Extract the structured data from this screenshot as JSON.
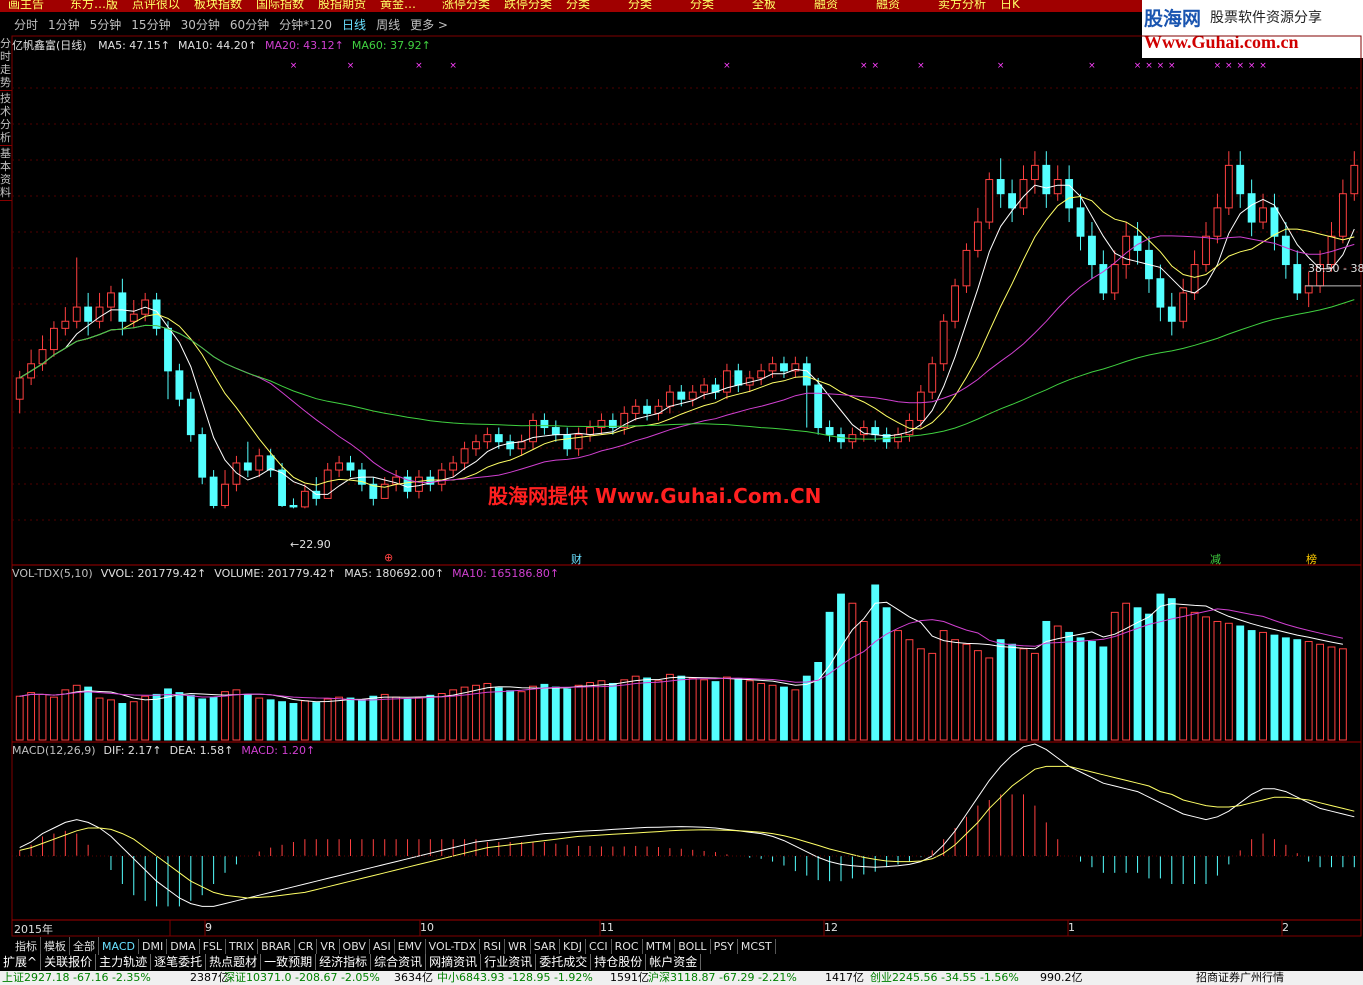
{
  "top_menu": [
    "画主告",
    "东方…版",
    "点评很以",
    "板块指数",
    "国际指数",
    "股指期货",
    "黄金…",
    "涨停分类",
    "跌停分类",
    "分类",
    "分类",
    "分类",
    "全板",
    "融资",
    "融资",
    "卖方分析",
    "日K"
  ],
  "timeframes": [
    {
      "label": "分时",
      "active": false
    },
    {
      "label": "1分钟",
      "active": false
    },
    {
      "label": "5分钟",
      "active": false
    },
    {
      "label": "15分钟",
      "active": false
    },
    {
      "label": "30分钟",
      "active": false
    },
    {
      "label": "60分钟",
      "active": false
    },
    {
      "label": "分钟*120",
      "active": false
    },
    {
      "label": "日线",
      "active": true
    },
    {
      "label": "周线",
      "active": false
    },
    {
      "label": "更多 >",
      "active": false
    }
  ],
  "logo": {
    "line1": "股海网",
    "line1b": "股票软件资源分享",
    "line2": "Www.Guhai.com.cn"
  },
  "side_tabs": [
    "分时走势",
    "技术分析",
    "基本资料"
  ],
  "watermark": "股海网提供 Www.Guhai.Com.CN",
  "price_panel": {
    "stock_title": "亿帆鑫富(日线)",
    "legend": [
      {
        "text": "MA5: 47.15↑",
        "color": "#e0e0e0"
      },
      {
        "text": "MA10: 44.20↑",
        "color": "#e0e0e0"
      },
      {
        "text": "MA20: 43.12↑",
        "color": "#d040d0"
      },
      {
        "text": "MA60: 37.92↑",
        "color": "#40d040"
      }
    ],
    "low_label": "←22.90",
    "cursor_label": "38.50 - 38",
    "event_markers": [
      {
        "text": "⊕",
        "color": "#ff4040"
      },
      {
        "text": "财",
        "color": "#6ae0ff"
      },
      {
        "text": "减",
        "color": "#40d040"
      },
      {
        "text": "榜",
        "color": "#ffcc00"
      }
    ]
  },
  "volume_panel": {
    "legend": [
      {
        "text": "VOL-TDX(5,10)",
        "color": "#c0c0c0"
      },
      {
        "text": "VVOL: 201779.42↑",
        "color": "#e0e0e0"
      },
      {
        "text": "VOLUME: 201779.42↑",
        "color": "#e0e0e0"
      },
      {
        "text": "MA5: 180692.00↑",
        "color": "#e0e0e0"
      },
      {
        "text": "MA10: 165186.80↑",
        "color": "#d040d0"
      }
    ]
  },
  "macd_panel": {
    "legend": [
      {
        "text": "MACD(12,26,9)",
        "color": "#c0c0c0"
      },
      {
        "text": "DIF: 2.17↑",
        "color": "#e0e0e0"
      },
      {
        "text": "DEA: 1.58↑",
        "color": "#e0e0e0"
      },
      {
        "text": "MACD: 1.20↑",
        "color": "#d040d0"
      }
    ]
  },
  "date_axis": [
    "2015年",
    "9",
    "10",
    "11",
    "12",
    "1",
    "2"
  ],
  "indicator_tabs": [
    {
      "label": "指标",
      "active": false
    },
    {
      "label": "模板",
      "active": false
    },
    {
      "label": "全部",
      "active": false
    },
    {
      "label": "MACD",
      "active": true
    },
    {
      "label": "DMI",
      "active": false
    },
    {
      "label": "DMA",
      "active": false
    },
    {
      "label": "FSL",
      "active": false
    },
    {
      "label": "TRIX",
      "active": false
    },
    {
      "label": "BRAR",
      "active": false
    },
    {
      "label": "CR",
      "active": false
    },
    {
      "label": "VR",
      "active": false
    },
    {
      "label": "OBV",
      "active": false
    },
    {
      "label": "ASI",
      "active": false
    },
    {
      "label": "EMV",
      "active": false
    },
    {
      "label": "VOL-TDX",
      "active": false
    },
    {
      "label": "RSI",
      "active": false
    },
    {
      "label": "WR",
      "active": false
    },
    {
      "label": "SAR",
      "active": false
    },
    {
      "label": "KDJ",
      "active": false
    },
    {
      "label": "CCI",
      "active": false
    },
    {
      "label": "ROC",
      "active": false
    },
    {
      "label": "MTM",
      "active": false
    },
    {
      "label": "BOLL",
      "active": false
    },
    {
      "label": "PSY",
      "active": false
    },
    {
      "label": "MCST",
      "active": false
    }
  ],
  "bottom_buttons": [
    "扩展^",
    "关联报价",
    "主力轨迹",
    "逐笔委托",
    "热点题材",
    "一致预期",
    "经济指标",
    "综合资讯",
    "网摘资讯",
    "行业资讯",
    "委托成交",
    "持仓股份",
    "帐户资金"
  ],
  "status_bar": [
    {
      "text": "上证2927.18 -67.16 -2.35%",
      "color": "#008000"
    },
    {
      "text": "2387亿",
      "color": "#000000"
    },
    {
      "text": "深证10371.0 -208.67 -2.05%",
      "color": "#008000"
    },
    {
      "text": "3634亿",
      "color": "#000000"
    },
    {
      "text": "中小6843.93 -128.95 -1.92%",
      "color": "#008000"
    },
    {
      "text": "1591亿",
      "color": "#000000"
    },
    {
      "text": "沪深3118.87 -67.29 -2.21%",
      "color": "#008000"
    },
    {
      "text": "1417亿",
      "color": "#000000"
    },
    {
      "text": "创业2245.56 -34.55 -1.56%",
      "color": "#008000"
    },
    {
      "text": "990.2亿",
      "color": "#000000"
    },
    {
      "text": "招商证券广州行情",
      "color": "#000000"
    }
  ],
  "chart_data": {
    "type": "candlestick",
    "title": "亿帆鑫富(日线)",
    "price_ylim": [
      20,
      55
    ],
    "candles": [
      [
        30.5,
        32,
        29.5,
        32.5
      ],
      [
        32,
        33,
        31.5,
        34
      ],
      [
        33,
        34,
        32.5,
        35
      ],
      [
        34,
        35.5,
        33.5,
        36
      ],
      [
        35.5,
        36,
        35,
        37
      ],
      [
        36,
        37,
        35.5,
        40.5
      ],
      [
        37,
        36,
        35,
        38
      ],
      [
        36,
        37,
        35.5,
        38
      ],
      [
        37,
        38,
        36,
        38.5
      ],
      [
        38,
        36,
        35,
        39
      ],
      [
        36,
        36.5,
        35.5,
        37.5
      ],
      [
        36.5,
        37.5,
        36,
        38
      ],
      [
        37.5,
        35.5,
        35,
        38
      ],
      [
        35.5,
        32.5,
        30.5,
        36
      ],
      [
        32.5,
        30.5,
        30,
        33
      ],
      [
        30.5,
        28,
        27.5,
        31
      ],
      [
        28,
        25,
        24.5,
        28.5
      ],
      [
        25,
        23,
        22.8,
        25.5
      ],
      [
        23,
        24.5,
        22.8,
        25.5
      ],
      [
        24.5,
        26,
        24,
        26.5
      ],
      [
        26,
        25.5,
        25,
        27.5
      ],
      [
        25.5,
        26.5,
        25,
        27
      ],
      [
        26.5,
        25.5,
        25,
        27
      ],
      [
        25.5,
        23,
        22.9,
        26
      ],
      [
        23,
        22.9,
        22.8,
        23.5
      ],
      [
        22.9,
        24,
        22.8,
        24.5
      ],
      [
        24,
        23.5,
        23,
        25
      ],
      [
        23.5,
        25.5,
        23.5,
        26
      ],
      [
        25.5,
        26,
        25,
        26.5
      ],
      [
        26,
        25.5,
        25,
        26.5
      ],
      [
        25.5,
        24.5,
        24,
        26
      ],
      [
        24.5,
        23.5,
        23,
        25
      ],
      [
        23.5,
        24.5,
        23.5,
        25
      ],
      [
        24.5,
        25,
        24,
        25.5
      ],
      [
        25,
        24,
        23.5,
        25.5
      ],
      [
        24,
        25,
        23.5,
        25.5
      ],
      [
        25,
        24.5,
        24,
        25.5
      ],
      [
        24.5,
        25.5,
        24,
        26
      ],
      [
        25.5,
        26,
        25,
        26.5
      ],
      [
        26,
        27,
        25.5,
        27.5
      ],
      [
        27,
        27.5,
        26.5,
        28
      ],
      [
        27.5,
        28,
        27,
        28.5
      ],
      [
        28,
        27.5,
        27,
        28.5
      ],
      [
        27.5,
        27,
        26.5,
        28
      ],
      [
        27,
        27.5,
        26.5,
        28
      ],
      [
        27.5,
        29,
        27,
        29.5
      ],
      [
        29,
        28.5,
        28,
        29.5
      ],
      [
        28.5,
        28,
        27.5,
        29
      ],
      [
        28,
        27,
        26.5,
        28.5
      ],
      [
        27,
        28,
        26.5,
        28.5
      ],
      [
        28,
        28.5,
        27.5,
        29
      ],
      [
        28.5,
        29,
        28,
        29.5
      ],
      [
        29,
        28.5,
        28,
        29.5
      ],
      [
        28.5,
        29.5,
        28,
        30
      ],
      [
        29.5,
        30,
        29,
        30.5
      ],
      [
        30,
        29.5,
        29,
        30.5
      ],
      [
        29.5,
        30,
        29,
        30.5
      ],
      [
        30,
        31,
        29.5,
        31.5
      ],
      [
        31,
        30.5,
        30,
        31.5
      ],
      [
        30.5,
        31,
        30,
        31.5
      ],
      [
        31,
        31.5,
        30.5,
        32
      ],
      [
        31.5,
        31,
        30.5,
        32
      ],
      [
        31,
        32.5,
        30.5,
        33
      ],
      [
        32.5,
        31.5,
        31,
        33
      ],
      [
        31.5,
        32,
        31,
        32.5
      ],
      [
        32,
        32.5,
        31.5,
        33
      ],
      [
        32.5,
        33,
        32,
        33.5
      ],
      [
        33,
        32.5,
        32,
        33.5
      ],
      [
        32.5,
        33,
        32,
        33.5
      ],
      [
        33,
        31.5,
        28.5,
        33.5
      ],
      [
        31.5,
        28.5,
        28,
        32
      ],
      [
        28.5,
        28,
        27.5,
        29
      ],
      [
        28,
        27.5,
        27,
        28.5
      ],
      [
        27.5,
        28,
        27,
        28.5
      ],
      [
        28,
        28.5,
        27.5,
        29
      ],
      [
        28.5,
        28,
        27.5,
        29
      ],
      [
        28,
        27.5,
        27,
        28.5
      ],
      [
        27.5,
        28,
        27,
        28.5
      ],
      [
        28,
        29,
        27.5,
        29.5
      ],
      [
        29,
        31,
        28.5,
        31.5
      ],
      [
        31,
        33,
        30.5,
        33.5
      ],
      [
        33,
        36,
        32.5,
        36.5
      ],
      [
        36,
        38.5,
        35.5,
        39
      ],
      [
        38.5,
        41,
        38,
        41.5
      ],
      [
        41,
        43,
        40.5,
        44
      ],
      [
        43,
        46,
        42.5,
        46.5
      ],
      [
        46,
        45,
        44,
        47.5
      ],
      [
        45,
        44,
        43,
        46
      ],
      [
        44,
        46,
        43.5,
        47
      ],
      [
        46,
        47,
        45,
        48
      ],
      [
        47,
        45,
        44,
        48
      ],
      [
        45,
        46,
        44.5,
        47
      ],
      [
        46,
        44,
        43,
        47
      ],
      [
        44,
        42,
        41,
        45
      ],
      [
        42,
        40,
        39,
        43
      ],
      [
        40,
        38,
        37.5,
        41
      ],
      [
        38,
        40,
        37.5,
        41
      ],
      [
        40,
        42,
        39,
        43
      ],
      [
        42,
        41,
        40,
        43
      ],
      [
        41,
        39,
        38,
        42
      ],
      [
        39,
        37,
        36,
        40
      ],
      [
        37,
        36,
        35,
        38
      ],
      [
        36,
        38,
        35.5,
        39
      ],
      [
        38,
        40,
        37.5,
        41
      ],
      [
        40,
        42,
        39.5,
        43
      ],
      [
        42,
        44,
        41.5,
        45
      ],
      [
        44,
        47,
        43.5,
        48
      ],
      [
        47,
        45,
        44,
        48
      ],
      [
        45,
        43,
        42,
        46
      ],
      [
        43,
        44,
        42.5,
        45
      ],
      [
        44,
        42,
        41,
        45
      ],
      [
        42,
        40,
        39,
        43
      ],
      [
        40,
        38,
        37.5,
        41
      ],
      [
        38,
        38.5,
        37,
        39.5
      ],
      [
        38.5,
        40,
        38,
        41
      ],
      [
        40,
        42,
        39.5,
        43
      ],
      [
        42,
        45,
        41.5,
        46
      ],
      [
        45,
        47,
        44.5,
        48
      ]
    ],
    "volume": [
      48,
      52,
      50,
      47,
      55,
      60,
      58,
      46,
      44,
      40,
      42,
      48,
      50,
      56,
      52,
      49,
      45,
      47,
      53,
      55,
      50,
      46,
      44,
      42,
      40,
      43,
      41,
      45,
      47,
      46,
      44,
      48,
      50,
      47,
      45,
      46,
      49,
      51,
      55,
      58,
      60,
      62,
      57,
      54,
      53,
      59,
      61,
      58,
      56,
      60,
      63,
      65,
      62,
      66,
      70,
      68,
      65,
      72,
      70,
      68,
      66,
      64,
      69,
      67,
      65,
      62,
      60,
      58,
      55,
      70,
      85,
      140,
      160,
      150,
      130,
      170,
      145,
      120,
      110,
      100,
      95,
      120,
      110,
      105,
      98,
      90,
      110,
      105,
      100,
      95,
      130,
      125,
      118,
      112,
      108,
      102,
      140,
      150,
      145,
      138,
      160,
      155,
      145,
      140,
      135,
      130,
      128,
      125,
      120,
      118,
      115,
      112,
      110,
      108,
      105,
      102,
      100
    ],
    "dif": [
      0.3,
      0.5,
      0.8,
      1.0,
      1.2,
      1.3,
      1.2,
      1.0,
      0.7,
      0.3,
      -0.1,
      -0.5,
      -0.9,
      -1.2,
      -1.5,
      -1.7,
      -1.8,
      -1.8,
      -1.7,
      -1.6,
      -1.5,
      -1.4,
      -1.3,
      -1.2,
      -1.1,
      -1.0,
      -0.9,
      -0.8,
      -0.7,
      -0.6,
      -0.5,
      -0.4,
      -0.3,
      -0.2,
      -0.1,
      0.0,
      0.1,
      0.2,
      0.3,
      0.4,
      0.5,
      0.55,
      0.6,
      0.65,
      0.7,
      0.75,
      0.8,
      0.82,
      0.85,
      0.88,
      0.9,
      0.92,
      0.95,
      0.97,
      1.0,
      1.02,
      1.03,
      1.04,
      1.05,
      1.04,
      1.03,
      1.0,
      0.95,
      0.9,
      0.85,
      0.8,
      0.7,
      0.55,
      0.35,
      0.15,
      -0.05,
      -0.2,
      -0.3,
      -0.35,
      -0.38,
      -0.4,
      -0.38,
      -0.35,
      -0.3,
      -0.2,
      0.0,
      0.4,
      0.9,
      1.5,
      2.1,
      2.7,
      3.2,
      3.6,
      3.9,
      4.0,
      3.8,
      3.5,
      3.2,
      3.0,
      2.8,
      2.6,
      2.5,
      2.4,
      2.3,
      2.1,
      1.9,
      1.7,
      1.5,
      1.4,
      1.3,
      1.4,
      1.6,
      1.9,
      2.2,
      2.4,
      2.4,
      2.3,
      2.1,
      1.9,
      1.7,
      1.6,
      1.5,
      1.4,
      1.3,
      1.2,
      1.1,
      1.2,
      1.5,
      1.8,
      2.0,
      2.17
    ],
    "dea": [
      0.2,
      0.3,
      0.45,
      0.6,
      0.75,
      0.9,
      1.0,
      1.0,
      0.95,
      0.8,
      0.6,
      0.3,
      0.0,
      -0.3,
      -0.6,
      -0.9,
      -1.1,
      -1.3,
      -1.4,
      -1.45,
      -1.5,
      -1.48,
      -1.45,
      -1.4,
      -1.35,
      -1.3,
      -1.2,
      -1.1,
      -1.0,
      -0.9,
      -0.8,
      -0.7,
      -0.6,
      -0.5,
      -0.4,
      -0.3,
      -0.2,
      -0.1,
      0.0,
      0.1,
      0.2,
      0.3,
      0.35,
      0.4,
      0.45,
      0.5,
      0.55,
      0.6,
      0.65,
      0.7,
      0.72,
      0.75,
      0.78,
      0.8,
      0.82,
      0.85,
      0.87,
      0.9,
      0.92,
      0.93,
      0.94,
      0.93,
      0.92,
      0.9,
      0.88,
      0.85,
      0.8,
      0.72,
      0.62,
      0.5,
      0.38,
      0.25,
      0.15,
      0.05,
      -0.05,
      -0.12,
      -0.18,
      -0.2,
      -0.2,
      -0.18,
      -0.1,
      0.1,
      0.4,
      0.8,
      1.2,
      1.7,
      2.1,
      2.5,
      2.8,
      3.1,
      3.2,
      3.2,
      3.2,
      3.1,
      3.0,
      2.9,
      2.8,
      2.7,
      2.6,
      2.5,
      2.3,
      2.2,
      2.0,
      1.9,
      1.8,
      1.75,
      1.75,
      1.8,
      1.9,
      2.0,
      2.1,
      2.1,
      2.05,
      2.0,
      1.9,
      1.8,
      1.7,
      1.6,
      1.5,
      1.45,
      1.4,
      1.38,
      1.4,
      1.45,
      1.52,
      1.58
    ]
  }
}
